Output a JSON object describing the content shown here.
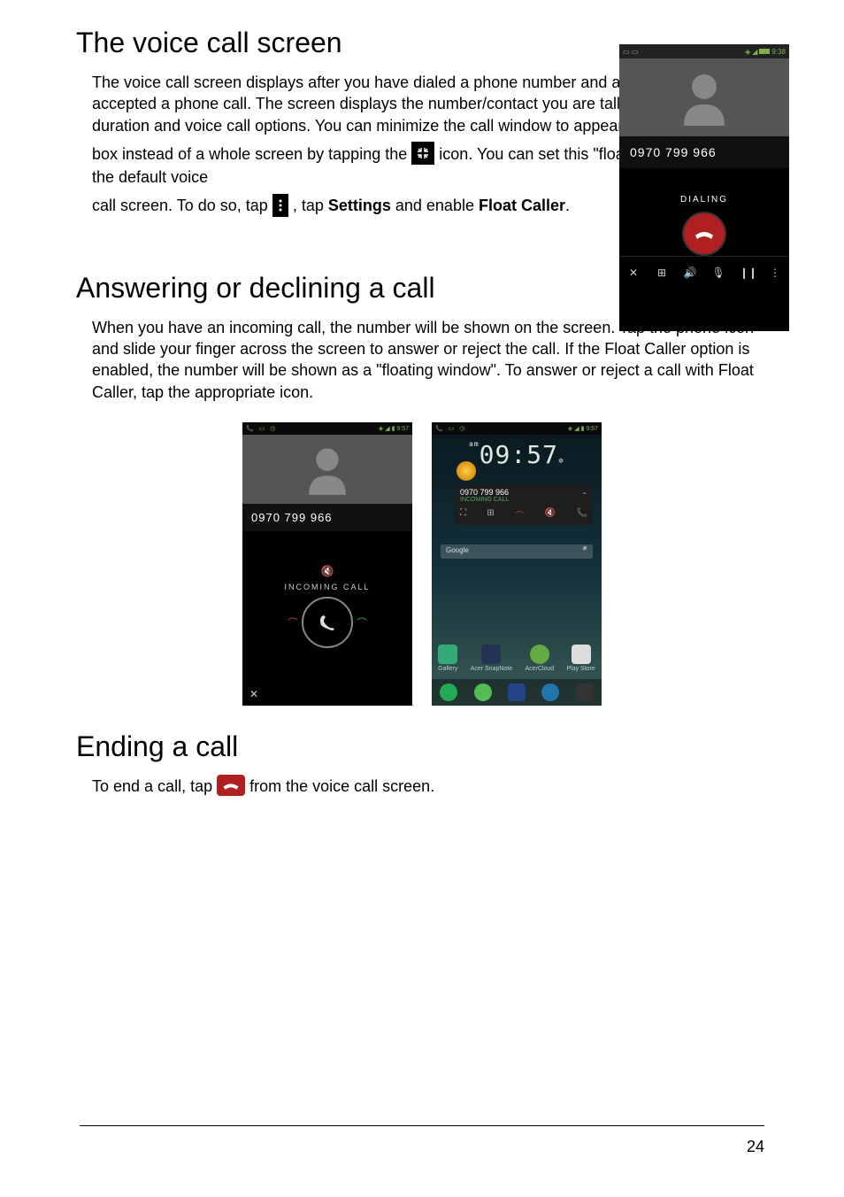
{
  "section1": {
    "title": "The voice call screen",
    "p1": "The voice call screen displays after you have dialed a phone number and after you have accepted a phone call. The screen displays the number/contact you are talking to, the call duration and voice call options. You can minimize the call window to appear as a small movable",
    "p2a": "box instead of a whole screen by tapping the ",
    "p2b": " icon. You can set this \"floating\" dialog box as the default voice",
    "p3a": "call screen. To do so, tap ",
    "p3b": ", tap ",
    "p3_settings": "Settings",
    "p3c": " and enable ",
    "p3_float": "Float Caller",
    "p3d": "."
  },
  "vc_phone": {
    "status_time": "9:38",
    "number": "0970 799 966",
    "dialing": "DIALING"
  },
  "section2": {
    "title": "Answering or declining a call",
    "p1": "When you have an incoming call, the number will be shown on the screen. Tap the phone icon and slide your finger across the screen to answer or reject the call. If the Float Caller option is enabled, the number will be shown as a \"floating window\". To answer or reject a call with Float Caller, tap the appropriate icon."
  },
  "incoming_phone": {
    "status_time": "9:57",
    "number": "0970 799 966",
    "label": "INCOMING CALL"
  },
  "home_phone": {
    "status_time": "9:57",
    "clock": "09:57",
    "clock_am": "am",
    "float_number": "0970 799 966",
    "float_sub": "INCOMING CALL",
    "google": "Google",
    "apps": [
      "Gallery",
      "Acer SnapNote",
      "AcerCloud",
      "Play Store"
    ]
  },
  "section3": {
    "title": "Ending a call",
    "p1a": "To end a call, tap ",
    "p1b": " from the voice call screen."
  },
  "page_number": "24"
}
